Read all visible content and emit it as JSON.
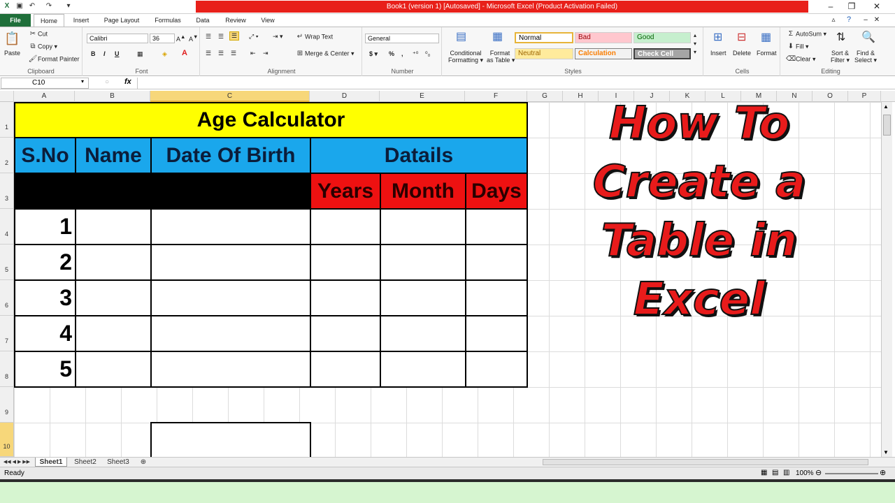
{
  "window": {
    "title": "Book1 (version 1) [Autosaved] - Microsoft Excel (Product Activation Failed)"
  },
  "tabs": [
    "File",
    "Home",
    "Insert",
    "Page Layout",
    "Formulas",
    "Data",
    "Review",
    "View"
  ],
  "ribbon": {
    "clipboard": {
      "paste": "Paste",
      "cut": "Cut",
      "copy": "Copy",
      "format_painter": "Format Painter",
      "label": "Clipboard"
    },
    "font": {
      "name": "Calibri",
      "size": "36",
      "label": "Font"
    },
    "alignment": {
      "wrap": "Wrap Text",
      "merge": "Merge & Center",
      "label": "Alignment"
    },
    "number": {
      "format": "General",
      "label": "Number"
    },
    "styles": {
      "conditional": "Conditional",
      "conditional2": "Formatting",
      "format_table": "Format",
      "format_table2": "as Table",
      "normal": "Normal",
      "bad": "Bad",
      "good": "Good",
      "neutral": "Neutral",
      "calculation": "Calculation",
      "check_cell": "Check Cell",
      "label": "Styles"
    },
    "cells": {
      "insert": "Insert",
      "delete": "Delete",
      "format": "Format",
      "label": "Cells"
    },
    "editing": {
      "autosum": "AutoSum",
      "fill": "Fill",
      "clear": "Clear",
      "sort": "Sort &",
      "sort2": "Filter",
      "find": "Find &",
      "find2": "Select",
      "label": "Editing"
    }
  },
  "formula_bar": {
    "name_box": "C10",
    "fx": "fx",
    "value": ""
  },
  "columns": [
    "A",
    "B",
    "C",
    "D",
    "E",
    "F",
    "G",
    "H",
    "I",
    "J",
    "K",
    "L",
    "M",
    "N",
    "O",
    "P"
  ],
  "rows": [
    "1",
    "2",
    "3",
    "4",
    "5",
    "6",
    "7",
    "8",
    "9",
    "10"
  ],
  "table": {
    "title": "Age Calculator",
    "h_sno": "S.No",
    "h_name": "Name",
    "h_dob": "Date Of Birth",
    "h_details": "Datails",
    "h_years": "Years",
    "h_month": "Month",
    "h_days": "Days",
    "sno": [
      "1",
      "2",
      "3",
      "4",
      "5"
    ]
  },
  "overlay": {
    "line1": "How To",
    "line2": "Create a",
    "line3": "Table in",
    "line4": "Excel"
  },
  "sheets": [
    "Sheet1",
    "Sheet2",
    "Sheet3"
  ],
  "status": {
    "ready": "Ready",
    "zoom": "100%"
  }
}
